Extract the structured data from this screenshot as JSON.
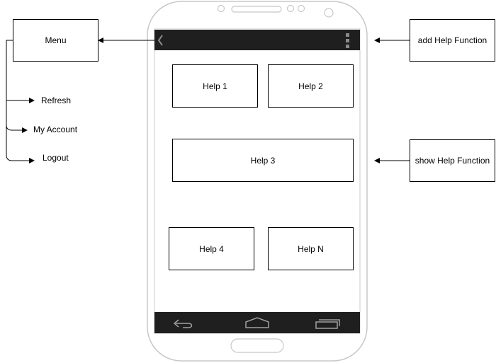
{
  "menu": {
    "title": "Menu",
    "items": [
      {
        "label": "Refresh"
      },
      {
        "label": "My Account"
      },
      {
        "label": "Logout"
      }
    ]
  },
  "help_tiles": [
    {
      "label": "Help 1"
    },
    {
      "label": "Help 2"
    },
    {
      "label": "Help 3"
    },
    {
      "label": "Help 4"
    },
    {
      "label": "Help N"
    }
  ],
  "annotations": {
    "add": "add Help Function",
    "show": "show Help Function"
  },
  "icons": {
    "back": "chevron-left-icon",
    "overflow": "overflow-menu-icon",
    "nav_back": "back-arrow-icon",
    "nav_home": "home-icon",
    "nav_recent": "recent-apps-icon"
  },
  "colors": {
    "bar": "#1f1f1f",
    "device_outline": "#c8c8c8",
    "line": "#000000"
  }
}
